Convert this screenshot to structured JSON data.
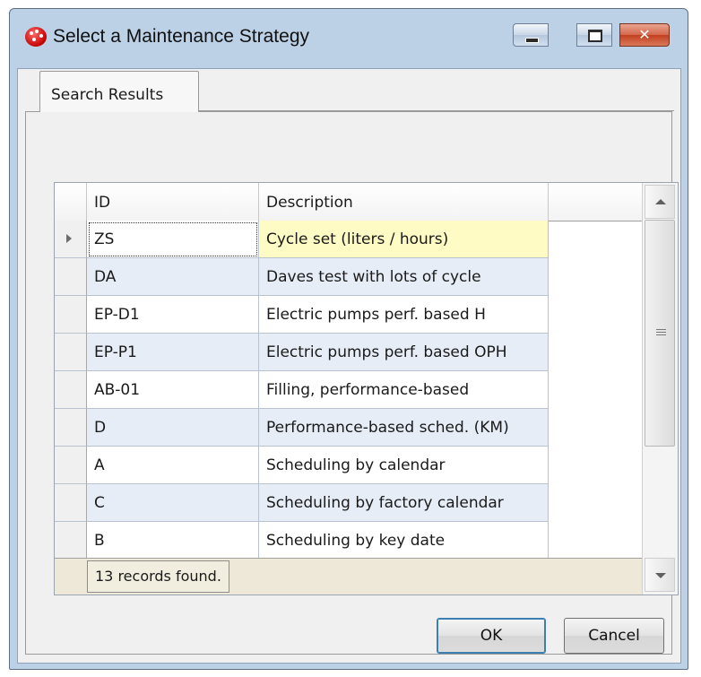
{
  "window": {
    "title": "Select a Maintenance Strategy",
    "controls": {
      "minimize_icon": "minimize-icon",
      "maximize_icon": "maximize-icon",
      "close_icon": "close-icon",
      "close_glyph": "✕"
    }
  },
  "tabs": [
    {
      "label": "Search Results",
      "active": true
    }
  ],
  "grid": {
    "columns": [
      "ID",
      "Description"
    ],
    "rows": [
      {
        "id": "ZS",
        "description": "Cycle set (liters / hours)",
        "selected": true
      },
      {
        "id": "DA",
        "description": "Daves test with lots of cycle"
      },
      {
        "id": "EP-D1",
        "description": "Electric pumps perf. based H"
      },
      {
        "id": "EP-P1",
        "description": "Electric pumps perf. based OPH"
      },
      {
        "id": "AB-01",
        "description": "Filling, performance-based"
      },
      {
        "id": "D",
        "description": "Performance-based sched. (KM)"
      },
      {
        "id": "A",
        "description": "Scheduling by calendar"
      },
      {
        "id": "C",
        "description": "Scheduling by factory calendar"
      },
      {
        "id": "B",
        "description": "Scheduling by key date"
      }
    ],
    "footer_text": "13 records found."
  },
  "buttons": {
    "ok": "OK",
    "cancel": "Cancel"
  },
  "colors": {
    "selected_row": "#fffbc4",
    "alt_row": "#e6edf6",
    "window_frame": "#bcd0e6",
    "close_button": "#c2401f"
  }
}
